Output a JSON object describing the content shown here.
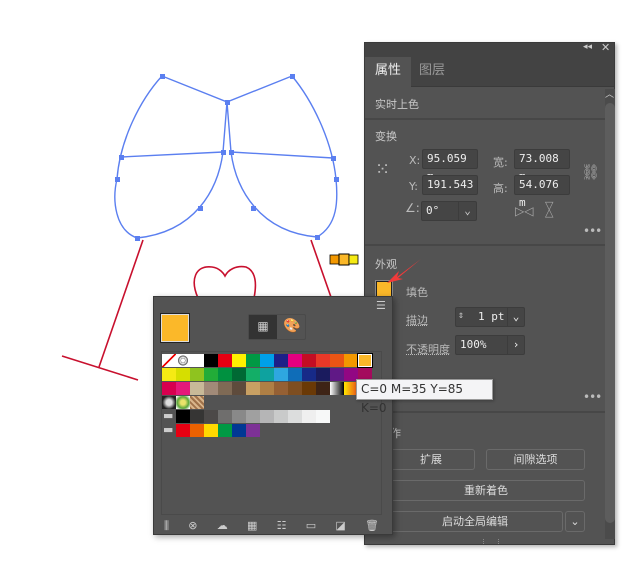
{
  "properties_panel": {
    "tabs": [
      {
        "label": "属性",
        "active": true
      },
      {
        "label": "图层",
        "active": false
      }
    ],
    "live_paint": "实时上色",
    "transform": {
      "title": "变换",
      "x_label": "X:",
      "x_value": "95.059 m",
      "y_label": "Y:",
      "y_value": "191.543",
      "w_label": "宽:",
      "w_value": "73.008 m",
      "h_label": "高:",
      "h_value": "54.076 m",
      "angle_value": "0°"
    },
    "appearance": {
      "title": "外观",
      "fill_label": "填色",
      "fill_color": "#FBB829",
      "stroke_label": "描边",
      "stroke_value": "1 pt",
      "opacity_label": "不透明度",
      "opacity_value": "100%"
    },
    "quick_actions": {
      "title": "操作",
      "expand": "扩展",
      "gap_options": "间隙选项",
      "recolor": "重新着色",
      "global_edit": "启动全局编辑"
    }
  },
  "swatches_panel": {
    "current_color": "#FBB829",
    "rows": [
      [
        "none",
        "registration",
        "#FFFFFF",
        "#000000",
        "#E60012",
        "#FFF100",
        "#009944",
        "#00A0E9",
        "#1D2088",
        "#E4007F",
        "#C30D23",
        "#E83828",
        "#EA5514",
        "#F39800",
        "#FBB829"
      ],
      [
        "#F5EA14",
        "#D6DE00",
        "#8FC31F",
        "#22AC38",
        "#009140",
        "#006934",
        "#13AE67",
        "#0EA29F",
        "#2EA7E0",
        "#0F6DB8",
        "#172A88",
        "#1A1B5E",
        "#601986",
        "#920783",
        "#A40B5D"
      ],
      [
        "#D7004F",
        "#E4197A",
        "#C8B998",
        "#A18A78",
        "#7F6A55",
        "#5E4B3C",
        "#C8A063",
        "#AF7F45",
        "#956034",
        "#7E4E21",
        "#6A3906",
        "#3E2416",
        "gradient-bw",
        "gradient-yo"
      ],
      [
        "pattern-dots",
        "pattern-leaf",
        "pattern-texture"
      ]
    ],
    "gray_group": [
      "#000000",
      "#363534",
      "#4C4948",
      "#6F6E6D",
      "#898989",
      "#A0A0A0",
      "#B5B5B6",
      "#C9CACA",
      "#DCDDDD",
      "#EFEFEF",
      "#F7F8F8"
    ],
    "color_group": [
      "#E60012",
      "#EB6100",
      "#FFD900",
      "#009944",
      "#003894",
      "#7D3196"
    ],
    "tooltip": "C=0 M=35 Y=85 K=0"
  }
}
